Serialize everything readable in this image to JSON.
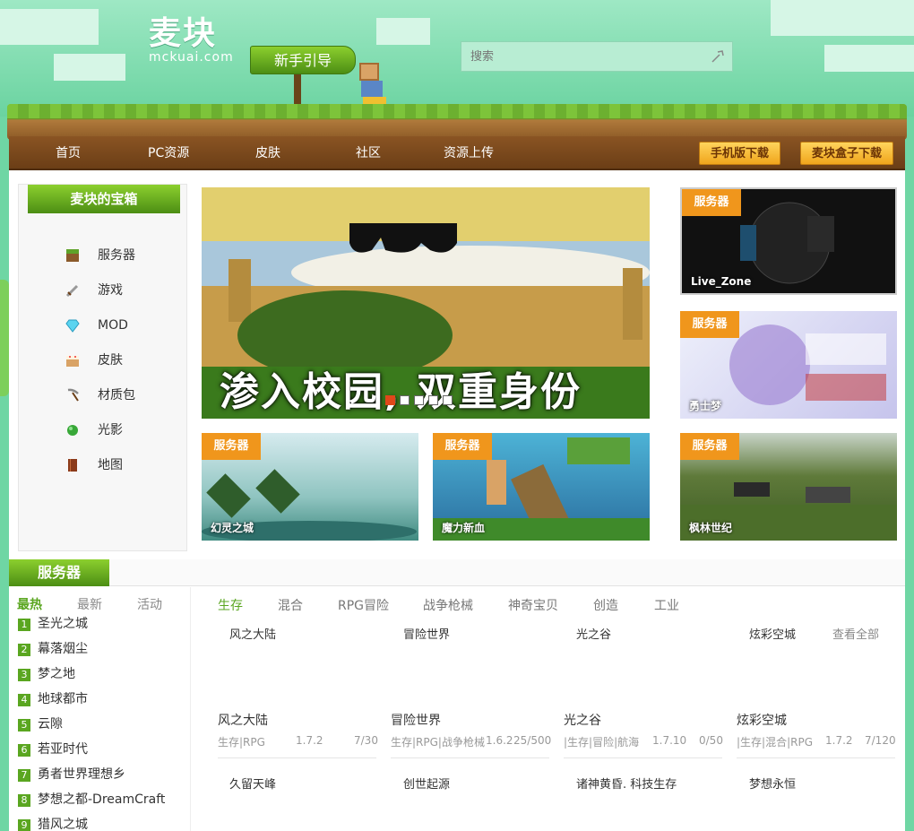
{
  "logo": {
    "main": "麦块",
    "sub": "mckuai.com"
  },
  "guide_label": "新手引导",
  "search": {
    "placeholder": "搜索"
  },
  "nav": {
    "items": [
      "首页",
      "PC资源",
      "皮肤",
      "社区",
      "资源上传"
    ],
    "mobile_download": "手机版下载",
    "box_download": "麦块盒子下载"
  },
  "treasure_box": {
    "title": "麦块的宝箱",
    "items": [
      {
        "label": "服务器",
        "icon": "grass-block-icon"
      },
      {
        "label": "游戏",
        "icon": "sword-icon"
      },
      {
        "label": "MOD",
        "icon": "diamond-icon"
      },
      {
        "label": "皮肤",
        "icon": "cake-icon"
      },
      {
        "label": "材质包",
        "icon": "pickaxe-icon"
      },
      {
        "label": "光影",
        "icon": "slimeball-icon"
      },
      {
        "label": "地图",
        "icon": "book-icon"
      }
    ]
  },
  "banner": {
    "caption": "渗入校园, 双重身份",
    "slide_count": 5,
    "active_slide": 1
  },
  "tiles": [
    {
      "badge": "服务器",
      "name": "Live_Zone"
    },
    {
      "badge": "服务器",
      "name": "勇士梦"
    },
    {
      "badge": "服务器",
      "name": "幻灵之城"
    },
    {
      "badge": "服务器",
      "name": "魔力新血"
    },
    {
      "badge": "服务器",
      "name": "枫林世纪"
    }
  ],
  "section": {
    "title": "服务器"
  },
  "rank": {
    "tabs": [
      "最热",
      "最新",
      "活动"
    ],
    "items": [
      "圣光之城",
      "幕落烟尘",
      "梦之地",
      "地球都市",
      "云隙",
      "若亚时代",
      "勇者世界理想乡",
      "梦想之都-DreamCraft",
      "猎风之城"
    ]
  },
  "categories": [
    "生存",
    "混合",
    "RPG冒险",
    "战争枪械",
    "神奇宝贝",
    "创造",
    "工业"
  ],
  "top_links": [
    "风之大陆",
    "冒险世界",
    "光之谷",
    "炫彩空城"
  ],
  "view_all": "查看全部",
  "cards": [
    {
      "name": "风之大陆",
      "tags": "生存|RPG",
      "version": "1.7.2",
      "players": "7/30"
    },
    {
      "name": "冒险世界",
      "tags": "生存|RPG|战争枪械",
      "version": "1.6.2",
      "players": "25/500"
    },
    {
      "name": "光之谷",
      "tags": "|生存|冒险|航海",
      "version": "1.7.10",
      "players": "0/50"
    },
    {
      "name": "炫彩空城",
      "tags": "|生存|混合|RPG",
      "version": "1.7.2",
      "players": "7/120"
    }
  ],
  "bottom_links": [
    "久留天峰",
    "创世起源",
    "诸神黄昏. 科技生存",
    "梦想永恒"
  ]
}
